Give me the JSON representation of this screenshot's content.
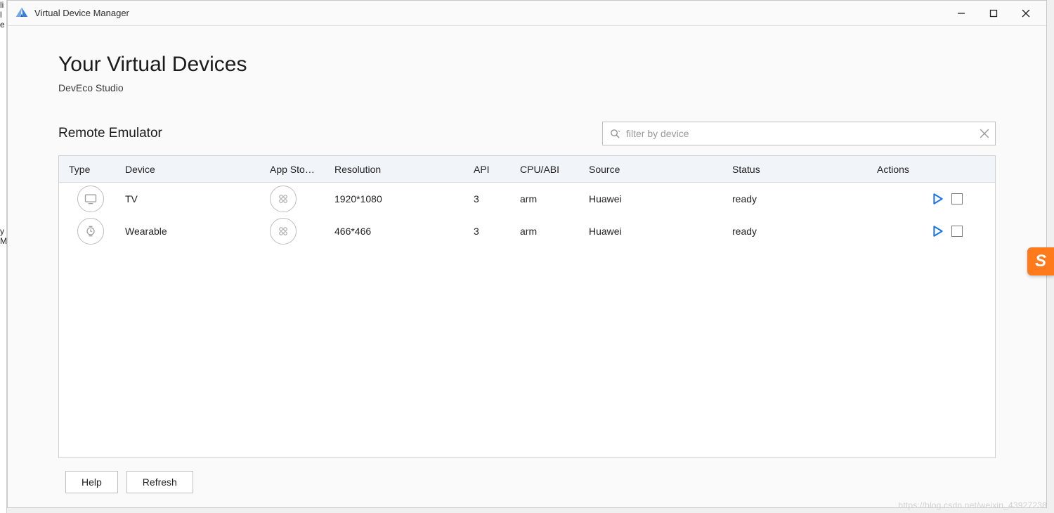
{
  "window": {
    "title": "Virtual Device Manager"
  },
  "page": {
    "title": "Your Virtual Devices",
    "subtitle": "DevEco Studio",
    "section": "Remote Emulator"
  },
  "search": {
    "placeholder": "filter by device",
    "value": ""
  },
  "table": {
    "headers": {
      "type": "Type",
      "device": "Device",
      "app": "App Sto…",
      "resolution": "Resolution",
      "api": "API",
      "cpu": "CPU/ABI",
      "source": "Source",
      "status": "Status",
      "actions": "Actions"
    },
    "rows": [
      {
        "type_icon": "tv-icon",
        "device": "TV",
        "resolution": "1920*1080",
        "api": "3",
        "cpu": "arm",
        "source": "Huawei",
        "status": "ready"
      },
      {
        "type_icon": "watch-icon",
        "device": "Wearable",
        "resolution": "466*466",
        "api": "3",
        "cpu": "arm",
        "source": "Huawei",
        "status": "ready"
      }
    ]
  },
  "footer": {
    "help": "Help",
    "refresh": "Refresh"
  },
  "badge": "S",
  "watermark": "https://blog.csdn.net/weixin_43927238"
}
